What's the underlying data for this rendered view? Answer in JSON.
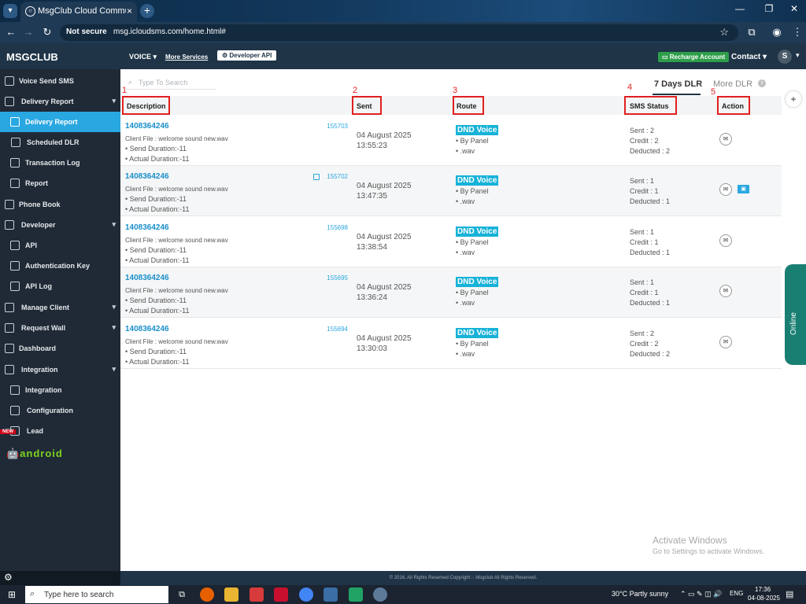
{
  "browser": {
    "tab_title": "MsgClub Cloud Communication",
    "tab_close": "×",
    "new_tab": "+",
    "security_label": "Not secure",
    "url": "msg.icloudsms.com/home.html#"
  },
  "header": {
    "brand": "MSGCLUB",
    "voice_menu": "VOICE",
    "more_services": "More Services",
    "developer_api": "Developer API",
    "recharge": "Recharge Account",
    "contact": "Contact",
    "avatar_initial": "S"
  },
  "sidebar": {
    "items": [
      {
        "label": "Voice Send SMS"
      },
      {
        "label": "Delivery Report"
      },
      {
        "label": "Delivery Report"
      },
      {
        "label": "Scheduled DLR"
      },
      {
        "label": "Transaction Log"
      },
      {
        "label": "Report"
      },
      {
        "label": "Phone Book"
      },
      {
        "label": "Developer"
      },
      {
        "label": "API"
      },
      {
        "label": "Authentication Key"
      },
      {
        "label": "API Log"
      },
      {
        "label": "Manage Client"
      },
      {
        "label": "Request Wall"
      },
      {
        "label": "Dashboard"
      },
      {
        "label": "Integration"
      },
      {
        "label": "Integration"
      },
      {
        "label": "Configuration"
      },
      {
        "label": "Lead"
      }
    ],
    "new_badge": "NEW",
    "android_label": "android"
  },
  "search": {
    "placeholder": "Type To Search"
  },
  "tabs": {
    "seven_days": "7 Days DLR",
    "more": "More DLR"
  },
  "table": {
    "headers": [
      "Description",
      "Sent",
      "Route",
      "SMS Status",
      "Action"
    ],
    "callouts": [
      "1",
      "2",
      "3",
      "4",
      "5"
    ],
    "rows": [
      {
        "number": "1408364246",
        "id": "155703",
        "client_file": "Client File : welcome sound new.wav",
        "send_duration": "• Send Duration:-11",
        "actual_duration": "• Actual Duration:-11",
        "date": "04 August 2025",
        "time": "13:55:23",
        "route": "DND Voice",
        "by_panel": "• By Panel",
        "wav": "• .wav",
        "sent": "Sent : 2",
        "credit": "Credit : 2",
        "deducted": "Deducted : 2"
      },
      {
        "number": "1408364246",
        "id": "155702",
        "client_file": "Client File : welcome sound new.wav",
        "send_duration": "• Send Duration:-11",
        "actual_duration": "• Actual Duration:-11",
        "date": "04 August 2025",
        "time": "13:47:35",
        "route": "DND Voice",
        "by_panel": "• By Panel",
        "wav": "• .wav",
        "sent": "Sent : 1",
        "credit": "Credit : 1",
        "deducted": "Deducted : 1"
      },
      {
        "number": "1408364246",
        "id": "155698",
        "client_file": "Client File : welcome sound new.wav",
        "send_duration": "• Send Duration:-11",
        "actual_duration": "• Actual Duration:-11",
        "date": "04 August 2025",
        "time": "13:38:54",
        "route": "DND Voice",
        "by_panel": "• By Panel",
        "wav": "• .wav",
        "sent": "Sent : 1",
        "credit": "Credit : 1",
        "deducted": "Deducted : 1"
      },
      {
        "number": "1408364246",
        "id": "155695",
        "client_file": "Client File : welcome sound new.wav",
        "send_duration": "• Send Duration:-11",
        "actual_duration": "• Actual Duration:-11",
        "date": "04 August 2025",
        "time": "13:36:24",
        "route": "DND Voice",
        "by_panel": "• By Panel",
        "wav": "• .wav",
        "sent": "Sent : 1",
        "credit": "Credit : 1",
        "deducted": "Deducted : 1"
      },
      {
        "number": "1408364246",
        "id": "155694",
        "client_file": "Client File : welcome sound new.wav",
        "send_duration": "• Send Duration:-11",
        "actual_duration": "• Actual Duration:-11",
        "date": "04 August 2025",
        "time": "13:30:03",
        "route": "DND Voice",
        "by_panel": "• By Panel",
        "wav": "• .wav",
        "sent": "Sent : 2",
        "credit": "Credit : 2",
        "deducted": "Deducted : 2"
      }
    ]
  },
  "online_label": "Online",
  "activate": {
    "title": "Activate Windows",
    "subtitle": "Go to Settings to activate Windows."
  },
  "footer": "© 2016, All Rights Reserved Copyright :- Msgclub All Rights Reserved.",
  "taskbar": {
    "search_text": "Type here to search",
    "weather": "30°C  Partly sunny",
    "lang": "ENG",
    "time": "17:36",
    "date": "04-08-2025"
  },
  "colors": {
    "accent": "#29a7e1",
    "header": "#1f3447",
    "sidebar": "#1f2a36",
    "route_badge": "#17b2d8",
    "callout": "#e02020",
    "recharge": "#2e9e4a"
  }
}
